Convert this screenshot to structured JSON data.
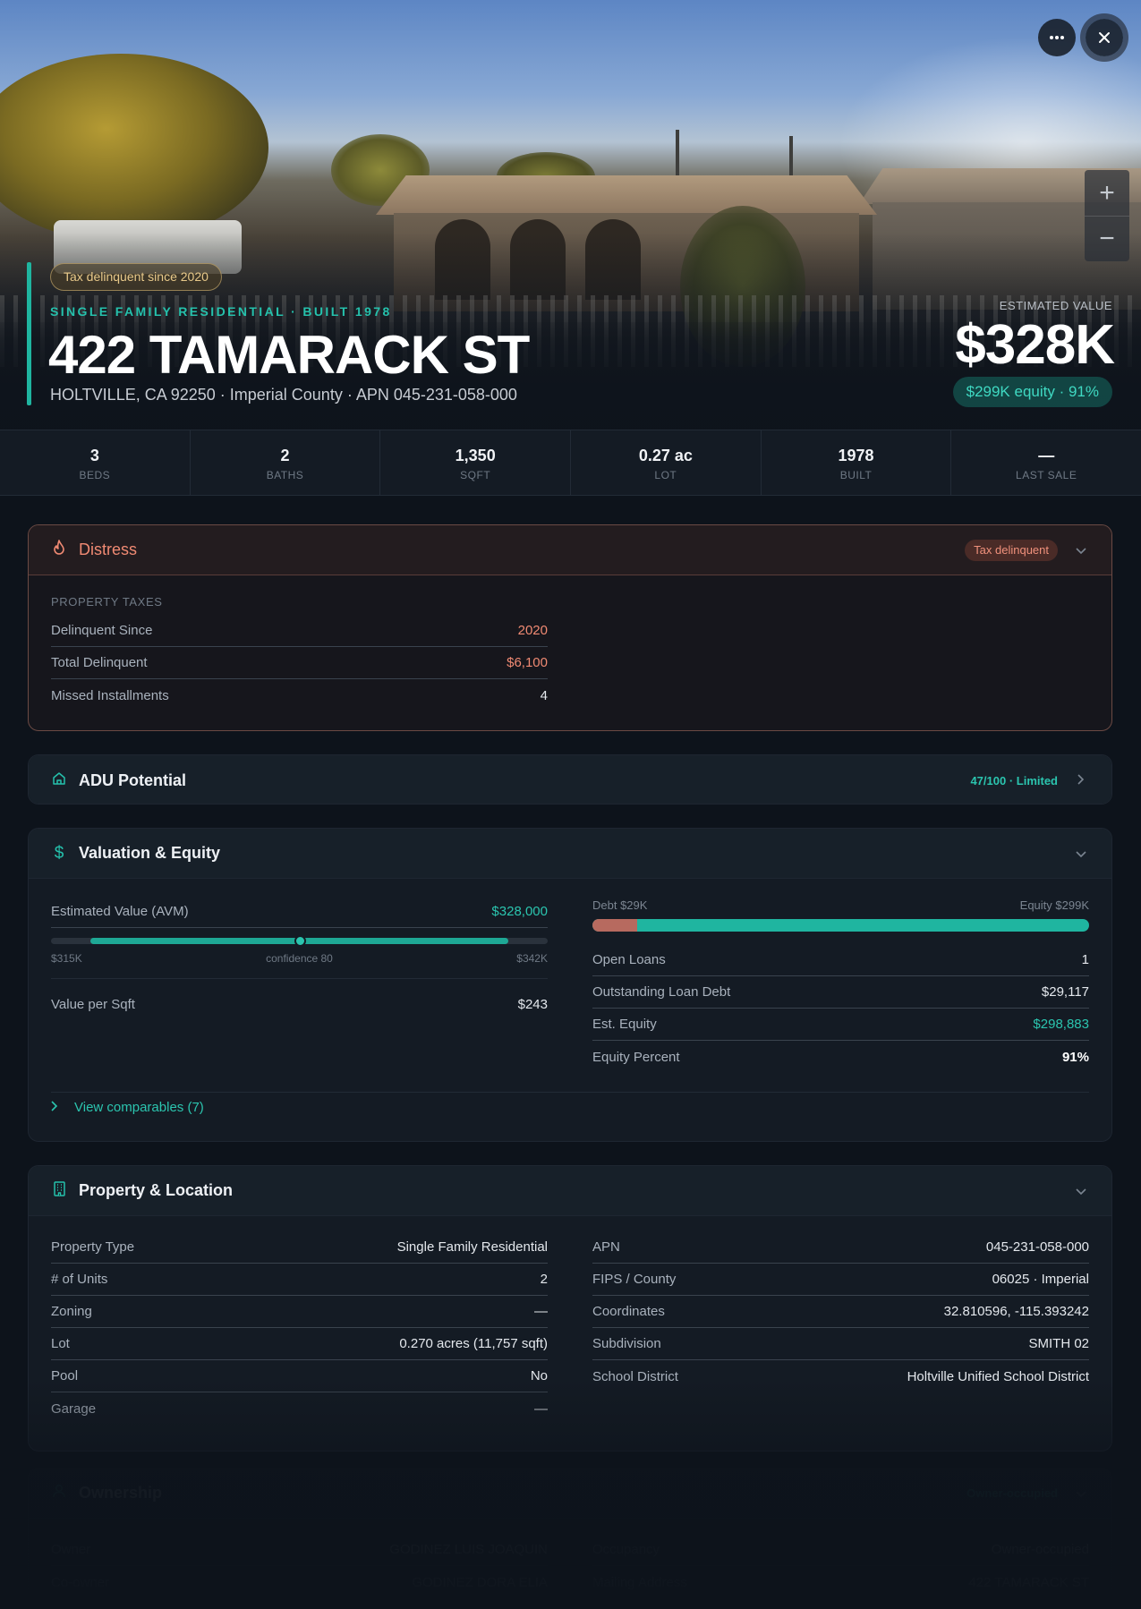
{
  "hero": {
    "tag": "Tax delinquent since 2020",
    "subtitle": "SINGLE FAMILY RESIDENTIAL · BUILT 1978",
    "title": "422 TAMARACK ST",
    "address": "HOLTVILLE, CA 92250 · Imperial County · APN 045-231-058-000",
    "estimated_label": "ESTIMATED VALUE",
    "estimated_value": "$328K",
    "equity_pill": "$299K equity · 91%",
    "more_icon": "more-horizontal-icon",
    "close_icon": "close-icon",
    "zoom_in": "+",
    "zoom_out": "−"
  },
  "stats": [
    {
      "value": "3",
      "label": "BEDS"
    },
    {
      "value": "2",
      "label": "BATHS"
    },
    {
      "value": "1,350",
      "label": "SQFT"
    },
    {
      "value": "0.27 ac",
      "label": "LOT"
    },
    {
      "value": "1978",
      "label": "BUILT"
    },
    {
      "value": "—",
      "label": "LAST SALE"
    }
  ],
  "distress": {
    "title": "Distress",
    "pill": "Tax delinquent",
    "section": "PROPERTY TAXES",
    "rows": [
      {
        "k": "Delinquent Since",
        "v": "2020"
      },
      {
        "k": "Total Delinquent",
        "v": "$6,100"
      },
      {
        "k": "Missed Installments",
        "v": "4"
      }
    ]
  },
  "adu": {
    "title": "ADU Potential",
    "score": "47/100 · Limited"
  },
  "valuation": {
    "title": "Valuation & Equity",
    "avm_label": "Estimated Value (AVM)",
    "avm_value": "$328,000",
    "range_low": "$315K",
    "confidence": "confidence 80",
    "range_high": "$342K",
    "avm_range_fraction": [
      0.08,
      0.92
    ],
    "avm_position_fraction": 0.5,
    "vps_label": "Value per Sqft",
    "vps_value": "$243",
    "debt_label": "Debt $29K",
    "equity_label": "Equity $299K",
    "debt_fraction": 0.09,
    "rows": [
      {
        "k": "Open Loans",
        "v": "1"
      },
      {
        "k": "Outstanding Loan Debt",
        "v": "$29,117"
      },
      {
        "k": "Est. Equity",
        "v": "$298,883"
      },
      {
        "k": "Equity Percent",
        "v": "91%"
      }
    ],
    "comparables": "View comparables (7)"
  },
  "location": {
    "title": "Property & Location",
    "left": [
      {
        "k": "Property Type",
        "v": "Single Family Residential"
      },
      {
        "k": "# of Units",
        "v": "2"
      },
      {
        "k": "Zoning",
        "v": "—"
      },
      {
        "k": "Lot",
        "v": "0.270 acres (11,757 sqft)"
      },
      {
        "k": "Pool",
        "v": "No"
      },
      {
        "k": "Garage",
        "v": "—"
      }
    ],
    "right": [
      {
        "k": "APN",
        "v": "045-231-058-000"
      },
      {
        "k": "FIPS / County",
        "v": "06025 · Imperial"
      },
      {
        "k": "Coordinates",
        "v": "32.810596, -115.393242"
      },
      {
        "k": "Subdivision",
        "v": "SMITH 02"
      },
      {
        "k": "School District",
        "v": "Holtville Unified School District"
      }
    ]
  },
  "ownership": {
    "title": "Ownership",
    "pill": "Owner-occupied",
    "left": [
      {
        "k": "Owner",
        "v": "GODINEZ LUIS JOAQUIN"
      },
      {
        "k": "Co-owner",
        "v": "GODINEZ DORA ELIA"
      }
    ],
    "right": [
      {
        "k": "Occupancy",
        "v": "Owner-occupied"
      },
      {
        "k": "Mailing Address",
        "v": "422 TAMARACK ST"
      }
    ]
  },
  "colors": {
    "accent": "#1fb5a0",
    "distress": "#f08a73",
    "background": "#0d131b"
  }
}
